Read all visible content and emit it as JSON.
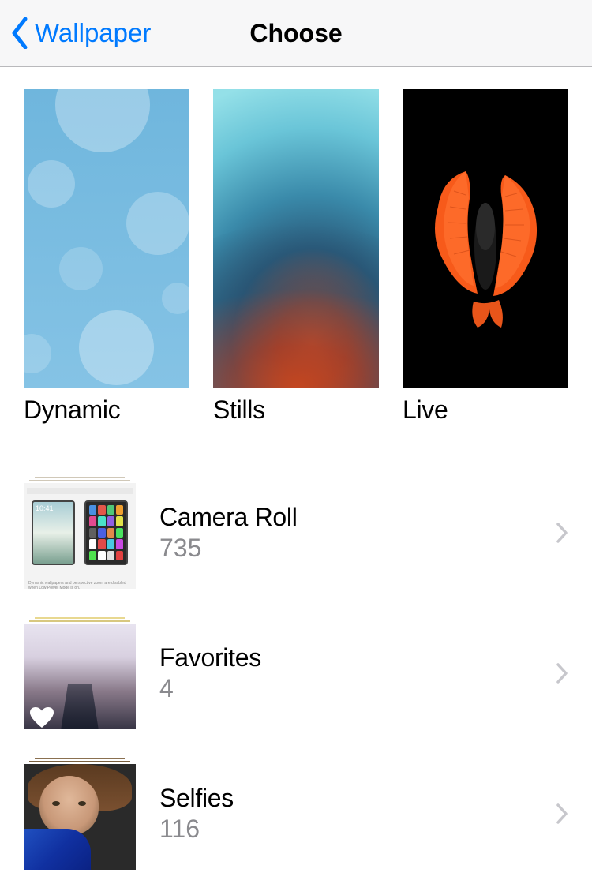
{
  "nav": {
    "back_label": "Wallpaper",
    "title": "Choose"
  },
  "categories": [
    {
      "label": "Dynamic"
    },
    {
      "label": "Stills"
    },
    {
      "label": "Live"
    }
  ],
  "albums": [
    {
      "title": "Camera Roll",
      "count": "735"
    },
    {
      "title": "Favorites",
      "count": "4"
    },
    {
      "title": "Selfies",
      "count": "116"
    }
  ]
}
